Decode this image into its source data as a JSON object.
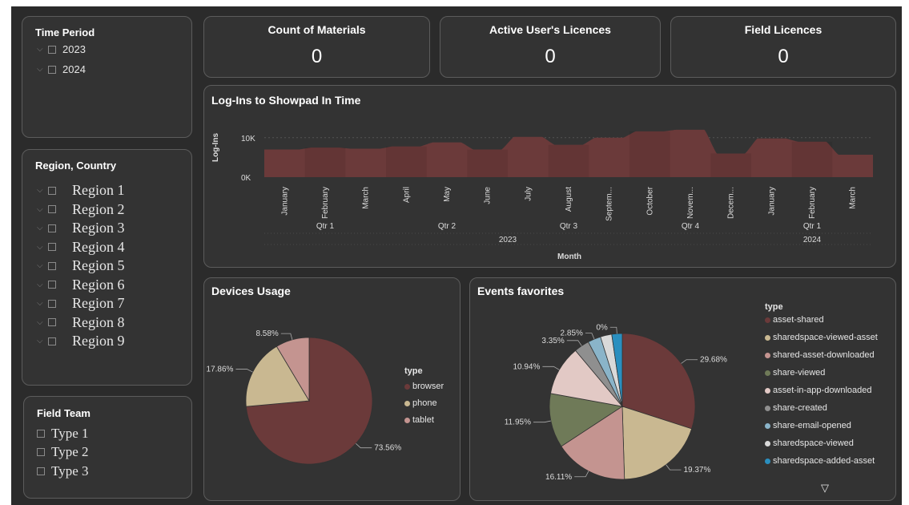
{
  "filters": {
    "time_period": {
      "title": "Time Period",
      "items": [
        "2023",
        "2024"
      ]
    },
    "region": {
      "title": "Region, Country",
      "items": [
        "Region 1",
        "Region 2",
        "Region 3",
        "Region 4",
        "Region 5",
        "Region 6",
        "Region 7",
        "Region 8",
        "Region 9"
      ]
    },
    "field_team": {
      "title": "Field Team",
      "items": [
        "Type 1",
        "Type 2",
        "Type 3"
      ]
    }
  },
  "kpis": [
    {
      "title": "Count of Materials",
      "value": "0"
    },
    {
      "title": "Active User's Licences",
      "value": "0"
    },
    {
      "title": "Field Licences",
      "value": "0"
    }
  ],
  "colors": {
    "canvas": "#2b2b2b",
    "panel": "#333333",
    "browser": "#6b3a3a",
    "phone": "#c9b891",
    "tablet": "#c49490"
  },
  "login_chart": {
    "title": "Log-Ins to Showpad In Time",
    "ylabel": "Log-Ins",
    "xlabel": "Month",
    "y_ticks": [
      "10K",
      "0K"
    ],
    "months": [
      "January",
      "February",
      "March",
      "April",
      "May",
      "June",
      "July",
      "August",
      "Septem...",
      "October",
      "Novem...",
      "Decem...",
      "January",
      "February",
      "March"
    ],
    "quarters": [
      "Qtr 1",
      "Qtr 2",
      "Qtr 3",
      "Qtr 4",
      "Qtr 1"
    ],
    "years": [
      "2023",
      "2024"
    ]
  },
  "devices": {
    "title": "Devices Usage",
    "legend_title": "type",
    "slices": [
      {
        "name": "browser",
        "label": "73.56%"
      },
      {
        "name": "phone",
        "label": "17.86%"
      },
      {
        "name": "tablet",
        "label": "8.58%"
      }
    ]
  },
  "events": {
    "title": "Events favorites",
    "legend_title": "type",
    "legend": [
      "asset-shared",
      "sharedspace-viewed-asset",
      "shared-asset-downloaded",
      "share-viewed",
      "asset-in-app-downloaded",
      "share-created",
      "share-email-opened",
      "sharedspace-viewed",
      "sharedspace-added-asset"
    ],
    "labels": [
      "29.68%",
      "19.37%",
      "16.11%",
      "11.95%",
      "10.94%",
      "3.35%",
      "2.85%",
      "0%"
    ]
  },
  "chart_data": [
    {
      "type": "area",
      "title": "Log-Ins to Showpad In Time",
      "xlabel": "Month",
      "ylabel": "Log-Ins",
      "x": [
        "January 2023",
        "February 2023",
        "March 2023",
        "April 2023",
        "May 2023",
        "June 2023",
        "July 2023",
        "August 2023",
        "September 2023",
        "October 2023",
        "November 2023",
        "December 2023",
        "January 2024",
        "February 2024",
        "March 2024"
      ],
      "values": [
        7000,
        7500,
        7200,
        7800,
        8800,
        7000,
        10200,
        8200,
        10000,
        11600,
        12000,
        6000,
        9800,
        9000,
        5700
      ],
      "ylim": [
        0,
        13000
      ],
      "y_ticks": [
        "10K",
        "0K"
      ]
    },
    {
      "type": "pie",
      "title": "Devices Usage",
      "categories": [
        "browser",
        "phone",
        "tablet"
      ],
      "values": [
        73.56,
        17.86,
        8.58
      ]
    },
    {
      "type": "pie",
      "title": "Events favorites",
      "categories": [
        "asset-shared",
        "sharedspace-viewed-asset",
        "shared-asset-downloaded",
        "share-viewed",
        "asset-in-app-downloaded",
        "share-created",
        "share-email-opened",
        "sharedspace-viewed",
        "sharedspace-added-asset"
      ],
      "values": [
        29.68,
        19.37,
        16.11,
        11.95,
        10.94,
        3.35,
        2.85,
        2.5,
        2.3
      ],
      "colors": [
        "#6b3a3a",
        "#c9b891",
        "#c49490",
        "#6f7a58",
        "#e2c9c5",
        "#8f8f8f",
        "#8ab4c9",
        "#d9d9d9",
        "#2a8fbf"
      ]
    }
  ]
}
